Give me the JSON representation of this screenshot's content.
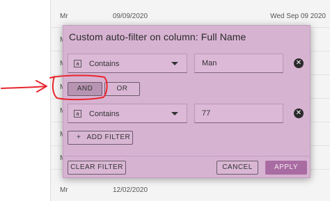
{
  "background": {
    "rows": [
      {
        "title": "Mr",
        "date": "09/09/2020",
        "long_date": "Wed Sep 09 2020"
      },
      {
        "title": "M",
        "date": "",
        "long_date": ""
      },
      {
        "title": "M",
        "date": "",
        "long_date": ""
      },
      {
        "title": "M",
        "date": "",
        "long_date": ""
      },
      {
        "title": "M",
        "date": "",
        "long_date": ""
      },
      {
        "title": "M",
        "date": "",
        "long_date": ""
      },
      {
        "title": "M",
        "date": "",
        "long_date": ""
      },
      {
        "title": "Mr",
        "date": "12/02/2020",
        "long_date": ""
      }
    ]
  },
  "dialog": {
    "title": "Custom auto-filter on column: Full Name",
    "filters": [
      {
        "type_icon": "a",
        "operator": "Contains",
        "value": "Man"
      },
      {
        "type_icon": "a",
        "operator": "Contains",
        "value": "77"
      }
    ],
    "logic": {
      "and_label": "AND",
      "or_label": "OR",
      "selected": "AND"
    },
    "add_filter_label": "ADD FILTER",
    "add_icon": "+",
    "clear_filter_label": "CLEAR FILTER",
    "cancel_label": "CANCEL",
    "apply_label": "APPLY"
  },
  "colors": {
    "dialog_bg": "#d7b3d2",
    "apply_bg": "#a96ca2",
    "annotation": "#e8262d"
  }
}
